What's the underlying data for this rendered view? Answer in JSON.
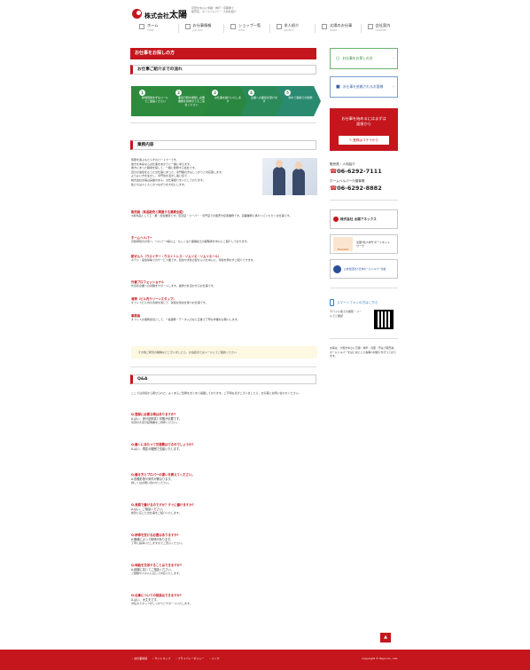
{
  "brand": {
    "company_prefix": "株式会社",
    "company_name": "太陽",
    "tagline_lines": [
      "京葉を中心に求職・神戸・京都隣で",
      "販売店、ホームヘルパー・人材仕紹介"
    ]
  },
  "gnav": [
    {
      "label": "ホーム",
      "en": "HOME",
      "icon": "home-icon"
    },
    {
      "label": "お仕事情報",
      "en": "JOB INFO",
      "icon": "briefcase-icon"
    },
    {
      "label": "ショップ一覧",
      "en": "SHOP",
      "icon": "shop-icon"
    },
    {
      "label": "求人紹介",
      "en": "RECRUIT",
      "icon": "person-icon"
    },
    {
      "label": "太陽のお仕事",
      "en": "WORK",
      "icon": "sun-icon"
    },
    {
      "label": "会社案内",
      "en": "COMPANY",
      "icon": "building-icon"
    }
  ],
  "main": {
    "page_title": "お仕事をお探しの方",
    "flow_heading": "お仕事ご紹介までの流れ",
    "flow_steps": [
      {
        "num": "1",
        "text": "新規登録まずはメールでご連絡ください",
        "color": "#2e8b3d"
      },
      {
        "num": "2",
        "text": "面接日時を調整し必要書類を持参のうえご来社ください",
        "color": "#2e8b3d"
      },
      {
        "num": "3",
        "text": "お仕事を紹介いたします",
        "color": "#2e8b3d"
      },
      {
        "num": "4",
        "text": "企業への面接を受けます",
        "color": "#2e8b3d"
      },
      {
        "num": "5",
        "text": "晴れて職場での勤務",
        "color": "#2e8b3d"
      }
    ],
    "business_heading": "業務内容",
    "intro_lines": [
      "笑顔を運ぶもたらすのパートナーです。",
      "貴方を本来ならお仕事をあかりと一緒に考えます。",
      "貴方にあった職場を探して、一緒に勤務する会社です。",
      "自分の適性をもったお仕事にあった、専門職の方もしっかりと対応致します。",
      "よりよい方を生かし、専門性を活かし長い目で…",
      "株式会社太陽は実績のある、お仕事紹介をいたしております。",
      "私たちは人と人とのつながりを大切にします。"
    ],
    "categories": [
      {
        "title": "販売員（商品販売と関連する業務全般）",
        "body": "※新商品として工・業・加合業態です。百貨店・スーパー・専門店での販売や接客業務です。店舗業務に携わっていただくお仕事です。"
      },
      {
        "title": "ホームヘルパー",
        "body": "高齢者様のお宅へ、ヘルパー2級以上、もしくは介護福祉士の経験者を中心にご紹介しております。"
      },
      {
        "title": "配ぜん人（ウエイター・ウエイトレス・ソムリエ・ソムリエール）",
        "body": "ホテル・宴会場等でのサービス業です。和食や洋食の配ぜん人を中心に、年齢を問わずご紹介できます。"
      },
      {
        "title": "外資プロフェッショナル",
        "body": "外資系企業への就職をサポートします。語学力を活かせるお仕事です。"
      },
      {
        "title": "清掃（ビル内クリーンスタッフ）",
        "body": "オフィスビル内の清掃を通じて、快適な環境を保つお仕事です。"
      },
      {
        "title": "事務員",
        "body": "オフィスの事務担当として、一般事務・データ入力など正確で丁寧な作業をお願いします。"
      }
    ],
    "callout": "その他ご希望の職種などございましたら、お電話またはメールにてご相談ください",
    "qa_heading": "Q&A",
    "qa_intro": "ここでは皆様から寄せられた、よくあるご質問をまとめて掲載しております。ご不明な点がございましたら、お気軽にお問い合わせください。",
    "qa": [
      {
        "q": "Q.登録に必要な物はありますか?",
        "a": "A.はい、身分証明書と印鑑が必要です。",
        "note": "写真付き身分証明書をご持参ください。"
      },
      {
        "q": "Q.働くにあたって交通費はでるのでしょうか?",
        "a": "A.はい、規定の範囲で支給いたします。",
        "note": ""
      },
      {
        "q": "Q.働き方とプロパーの違いを教えてください。",
        "a": "A.勤務形態や条件が異なります。",
        "note": "詳しくはお問い合わせください。"
      },
      {
        "q": "Q.長期で働けるのですか？すぐに働けますか?",
        "a": "A.はい、ご相談ください。",
        "note": "希望に応じたお仕事をご紹介いたします。"
      },
      {
        "q": "Q.研修を受ける必要はありますか?",
        "a": "A.職種によって研修があります。",
        "note": "丁寧に指導いたしますのでご安心ください。"
      },
      {
        "q": "Q.時給を交渉することはできますか?",
        "a": "A.経験に応じてご相談ください。",
        "note": "ご経験やスキルに応じて対応いたします。"
      },
      {
        "q": "Q.仕事についての相談はできますか?",
        "a": "A.はい、大丈夫です。",
        "note": "専任のスタッフがしっかりとサポートいたします。"
      }
    ]
  },
  "sidebar": {
    "link1": "お仕事をお探しの方",
    "link2": "お仕事を依頼されるお客様",
    "banner_lines": [
      "お仕事を始めるにはまずは面接から"
    ],
    "banner_btn": "登録はコチラから",
    "banner_color": "#c4161c",
    "contact_sales_label": "販売員・人材紹介",
    "contact_sales_tel": "06-6292-7111",
    "contact_helper_label": "ホームヘルパー介護事業",
    "contact_helper_tel": "06-6292-8882",
    "annex": "株式会社 太陽アネックス",
    "partner2_name": "Tracomnt",
    "partner2_desc": "全国7社人材サポートネットワーク",
    "partner3_desc": "公益社団法人日本ホームヘルパー協会",
    "smartphone": "スマートフォンの方はこちら",
    "qr_desc": "モバイル版での閲覧・メールでご確認",
    "about_text": "太陽は、大阪を中心に京都・神戸・兵庫・奈良で販売員、ホームヘルパーをはじめとした各種人材紹介を行っております。"
  },
  "footer": {
    "links": [
      "お仕事情報",
      "サイトマップ",
      "プライバシーポリシー",
      "リンク"
    ],
    "copyright": "Copyright © Taiyo Co., Ltd.",
    "totop": "▲"
  }
}
